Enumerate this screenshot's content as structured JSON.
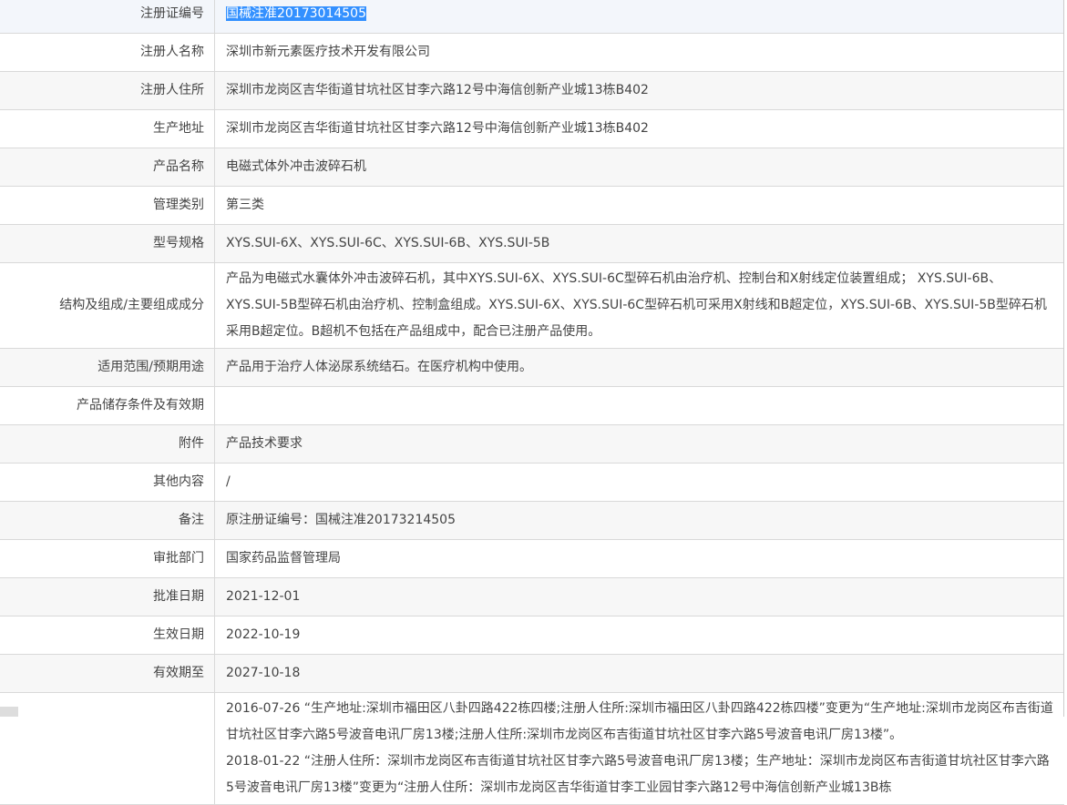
{
  "rows": [
    {
      "label": "注册证编号",
      "value": "国械注准20173014505"
    },
    {
      "label": "注册人名称",
      "value": "深圳市新元素医疗技术开发有限公司"
    },
    {
      "label": "注册人住所",
      "value": "深圳市龙岗区吉华街道甘坑社区甘李六路12号中海信创新产业城13栋B402"
    },
    {
      "label": "生产地址",
      "value": "深圳市龙岗区吉华街道甘坑社区甘李六路12号中海信创新产业城13栋B402"
    },
    {
      "label": "产品名称",
      "value": "电磁式体外冲击波碎石机"
    },
    {
      "label": "管理类别",
      "value": "第三类"
    },
    {
      "label": "型号规格",
      "value": "XYS.SUI-6X、XYS.SUI-6C、XYS.SUI-6B、XYS.SUI-5B"
    },
    {
      "label": "结构及组成/主要组成成分",
      "value": "产品为电磁式水囊体外冲击波碎石机，其中XYS.SUI-6X、XYS.SUI-6C型碎石机由治疗机、控制台和X射线定位装置组成； XYS.SUI-6B、XYS.SUI-5B型碎石机由治疗机、控制盒组成。XYS.SUI-6X、XYS.SUI-6C型碎石机可采用X射线和B超定位，XYS.SUI-6B、XYS.SUI-5B型碎石机采用B超定位。B超机不包括在产品组成中，配合已注册产品使用。"
    },
    {
      "label": "适用范围/预期用途",
      "value": "产品用于治疗人体泌尿系统结石。在医疗机构中使用。"
    },
    {
      "label": "产品储存条件及有效期",
      "value": ""
    },
    {
      "label": "附件",
      "value": "产品技术要求"
    },
    {
      "label": "其他内容",
      "value": "/"
    },
    {
      "label": "备注",
      "value": "原注册证编号：国械注准20173214505"
    },
    {
      "label": "审批部门",
      "value": "国家药品监督管理局"
    },
    {
      "label": "批准日期",
      "value": "2021-12-01"
    },
    {
      "label": "生效日期",
      "value": "2022-10-19"
    },
    {
      "label": "有效期至",
      "value": "2027-10-18"
    }
  ],
  "changes": [
    "2016-07-26 “生产地址:深圳市福田区八卦四路422栋四楼;注册人住所:深圳市福田区八卦四路422栋四楼”变更为“生产地址:深圳市龙岗区布吉街道甘坑社区甘李六路5号波音电讯厂房13楼;注册人住所:深圳市龙岗区布吉街道甘坑社区甘李六路5号波音电讯厂房13楼”。",
    "2018-01-22 “注册人住所：深圳市龙岗区布吉街道甘坑社区甘李六路5号波音电讯厂房13楼；生产地址：深圳市龙岗区布吉街道甘坑社区甘李六路5号波音电讯厂房13楼”变更为“注册人住所：深圳市龙岗区吉华街道甘李工业园甘李六路12号中海信创新产业城13B栋"
  ]
}
